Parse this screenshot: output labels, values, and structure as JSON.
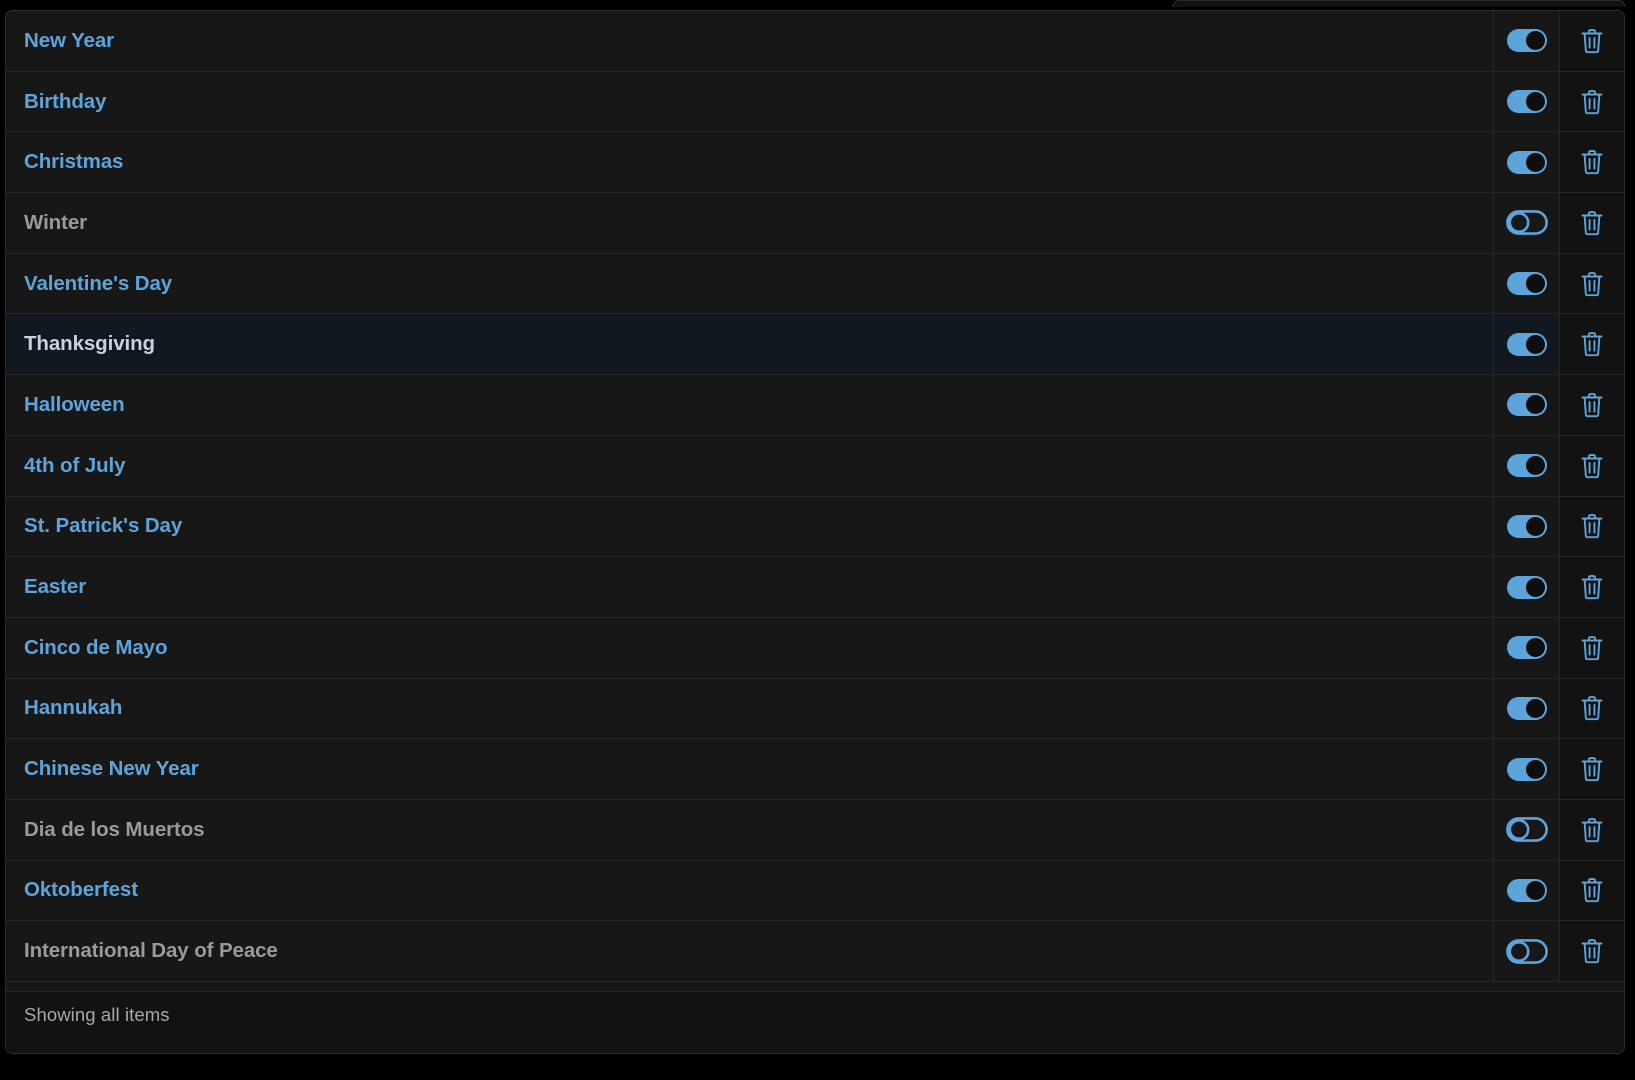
{
  "table": {
    "accent_on_color": "#5da4da",
    "accent_off_color": "#9a9a9a",
    "hover_row_bg": "#111820",
    "row_bg": "#171717",
    "columns": [
      "name",
      "enabled-toggle",
      "delete-action"
    ],
    "rows": [
      {
        "name": "New Year",
        "enabled": true,
        "hovered": false,
        "toggle_state": "on",
        "delete_label": "Delete"
      },
      {
        "name": "Birthday",
        "enabled": true,
        "hovered": false,
        "toggle_state": "on",
        "delete_label": "Delete"
      },
      {
        "name": "Christmas",
        "enabled": true,
        "hovered": false,
        "toggle_state": "on",
        "delete_label": "Delete"
      },
      {
        "name": "Winter",
        "enabled": false,
        "hovered": false,
        "toggle_state": "off",
        "delete_label": "Delete"
      },
      {
        "name": "Valentine's Day",
        "enabled": true,
        "hovered": false,
        "toggle_state": "on",
        "delete_label": "Delete"
      },
      {
        "name": "Thanksgiving",
        "enabled": true,
        "hovered": true,
        "toggle_state": "on",
        "delete_label": "Delete"
      },
      {
        "name": "Halloween",
        "enabled": true,
        "hovered": false,
        "toggle_state": "on",
        "delete_label": "Delete"
      },
      {
        "name": "4th of July",
        "enabled": true,
        "hovered": false,
        "toggle_state": "on",
        "delete_label": "Delete"
      },
      {
        "name": "St. Patrick's Day",
        "enabled": true,
        "hovered": false,
        "toggle_state": "on",
        "delete_label": "Delete"
      },
      {
        "name": "Easter",
        "enabled": true,
        "hovered": false,
        "toggle_state": "on",
        "delete_label": "Delete"
      },
      {
        "name": "Cinco de Mayo",
        "enabled": true,
        "hovered": false,
        "toggle_state": "on",
        "delete_label": "Delete"
      },
      {
        "name": "Hannukah",
        "enabled": true,
        "hovered": false,
        "toggle_state": "on",
        "delete_label": "Delete"
      },
      {
        "name": "Chinese New Year",
        "enabled": true,
        "hovered": false,
        "toggle_state": "on",
        "delete_label": "Delete"
      },
      {
        "name": "Dia de los Muertos",
        "enabled": false,
        "hovered": false,
        "toggle_state": "off",
        "delete_label": "Delete"
      },
      {
        "name": "Oktoberfest",
        "enabled": true,
        "hovered": false,
        "toggle_state": "on",
        "delete_label": "Delete"
      },
      {
        "name": "International Day of Peace",
        "enabled": false,
        "hovered": false,
        "toggle_state": "off",
        "delete_label": "Delete"
      }
    ]
  },
  "footer": {
    "status_text": "Showing all items"
  },
  "icons": {
    "toggle": "toggle-switch-icon",
    "delete": "trash-icon"
  }
}
